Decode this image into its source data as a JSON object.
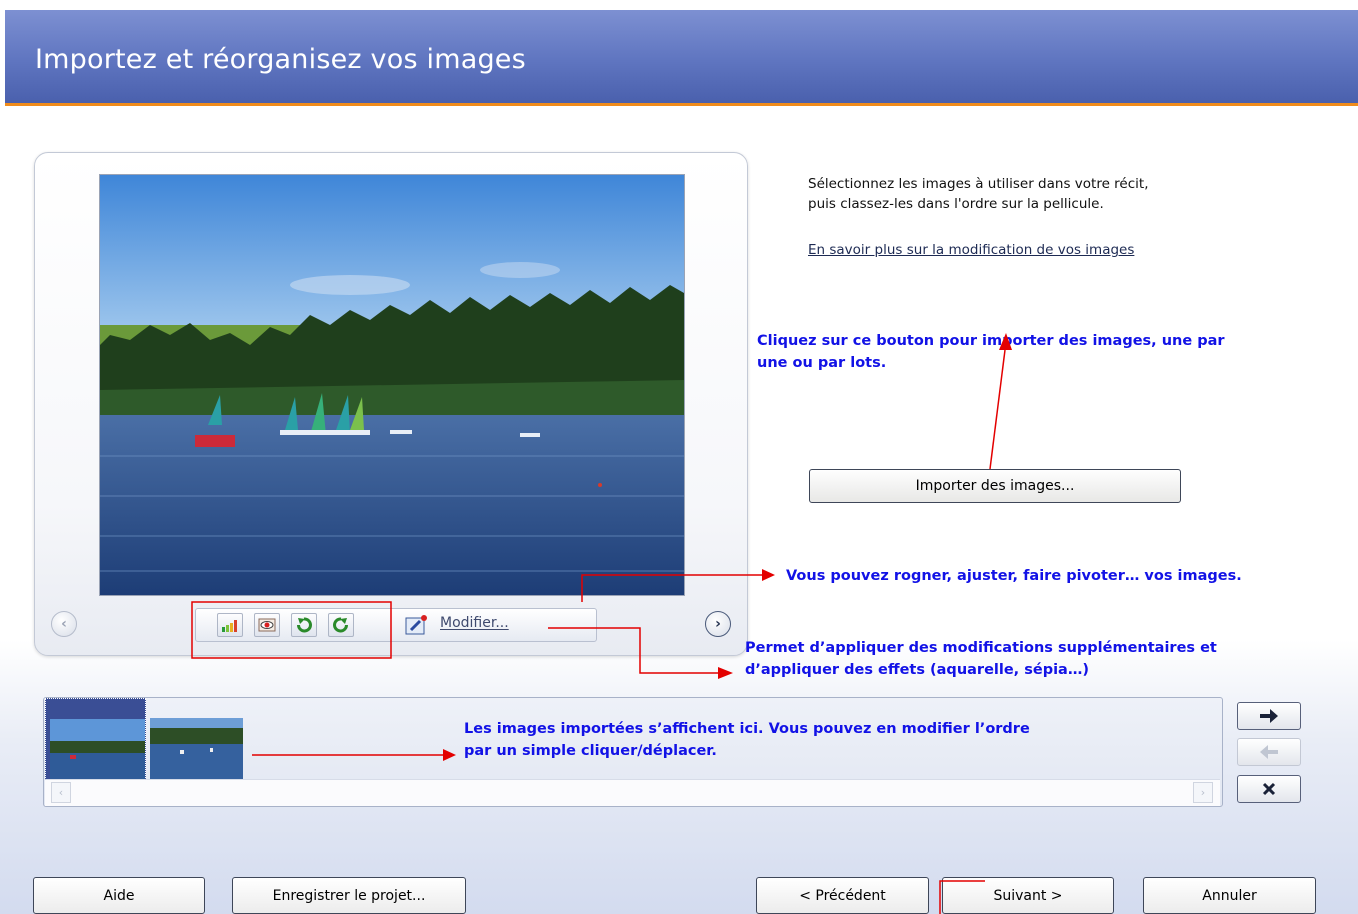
{
  "header": {
    "title": "Importez et réorganisez vos images"
  },
  "preview": {
    "prev_icon": "chevron-left-icon",
    "next_icon": "chevron-right-icon",
    "toolbar": {
      "icons": [
        "auto-adjust-icon",
        "red-eye-icon",
        "rotate-left-icon",
        "rotate-right-icon",
        "edit-icon"
      ],
      "modify_label": "Modifier..."
    }
  },
  "instructions": {
    "line1": "Sélectionnez les images à utiliser dans votre récit,",
    "line2": "puis classez-les dans l'ordre sur la pellicule.",
    "link": "En savoir plus sur la modification de vos images"
  },
  "import_button": "Importer des images...",
  "annotations": {
    "import_line1": "Cliquez sur ce bouton pour importer des images, une par",
    "import_line2": "une ou par lots.",
    "crop": "Vous pouvez rogner, ajuster, faire pivoter… vos images.",
    "effects_line1": "Permet d’appliquer des modifications supplémentaires et",
    "effects_line2": "d’appliquer des effets (aquarelle, sépia…)",
    "filmstrip_line1": "Les images importées s’affichent ici. Vous pouvez en modifier l’ordre",
    "filmstrip_line2": "par un simple cliquer/déplacer."
  },
  "filmstrip": {
    "thumbnails": [
      "thumbnail-1",
      "thumbnail-2"
    ],
    "side_buttons": [
      "arrow-right-icon",
      "arrow-left-icon",
      "delete-icon"
    ]
  },
  "footer": {
    "help": "Aide",
    "save_project": "Enregistrer le projet...",
    "previous": "< Précédent",
    "next": "Suivant >",
    "cancel": "Annuler"
  },
  "colors": {
    "header": "#5f75c0",
    "header_accent": "#f08c1c",
    "annotation": "#1212e6",
    "arrow": "#e30000"
  }
}
